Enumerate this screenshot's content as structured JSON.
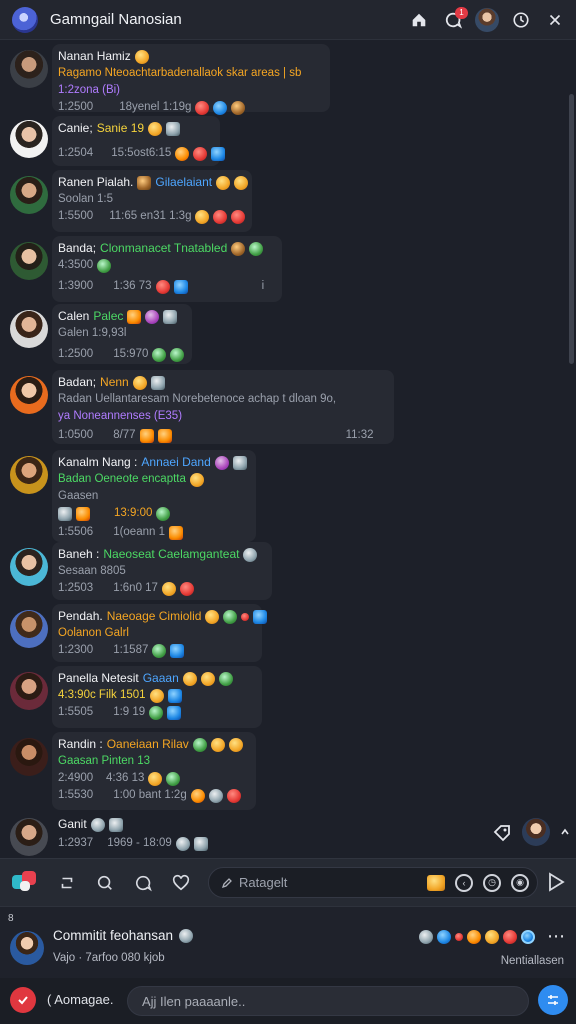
{
  "app": {
    "title": "Gamngail Nanosian"
  },
  "topbar": {
    "badge": "1"
  },
  "messages": [
    {
      "name": "Nanan Hamiz",
      "lines": [
        "Ragamo Nteoachtarbadenallaok skar areas | sb",
        "1:2zona (Bi)"
      ],
      "time": "1:2500",
      "meta": "18yenel 1:19g"
    },
    {
      "name": "Canie;",
      "tag": "Sanie 19",
      "time": "1:2504",
      "meta": "15:5ost6:15"
    },
    {
      "name": "Ranen Pialah.",
      "tag": "Gilaelaiant",
      "lines": [
        "Soolan 1:5"
      ],
      "time": "1:5500",
      "meta": "11:65 en31 1:3g"
    },
    {
      "name": "Banda;",
      "tag": "Clonmanacet Tnatabled",
      "lines": [
        "4:3500"
      ],
      "time": "1:3900",
      "meta": "1:36 73",
      "extra": "i"
    },
    {
      "name": "Calen",
      "tag": "Palec",
      "lines": [
        "Galen 1:9,93l"
      ],
      "time": "1:2500",
      "meta": "15:970"
    },
    {
      "name": "Badan;",
      "tag": "Nenn",
      "lines": [
        "Radan Uellantaresam Norebetenoce achap t dloan 9o,",
        "ya Noneannenses (E35)"
      ],
      "time": "1:0500",
      "meta": "8/77",
      "right": "11:32"
    },
    {
      "name": "Kanalm Nang :",
      "tag": "Annaei Dand",
      "lines": [
        "Badan Oeneote encaptta",
        "Gaasen",
        "13:9:00"
      ],
      "time": "1:5506",
      "meta": "1(oeann 1"
    },
    {
      "name": "Baneh :",
      "tag": "Naeoseat Caelamganteat",
      "lines": [
        "Sesaan 8805"
      ],
      "time": "1:2503",
      "meta": "1:6n0 17"
    },
    {
      "name": "Pendah.",
      "tag": "Naeoage Cimiolid",
      "lines": [
        "Oolanon Galrl"
      ],
      "time": "1:2300",
      "meta": "1:1587"
    },
    {
      "name": "Panella Netesit",
      "tag": "Gaaan",
      "lines": [
        "4:3:90c Filk 1501"
      ],
      "time": "1:5505",
      "meta": "1:9 19"
    },
    {
      "name": "Randin :",
      "tag": "Oaneiaan Rilav",
      "lines": [
        "Gaasan Pinten 13",
        "2:4900",
        "4:36 13"
      ],
      "time": "1:5530",
      "meta": "1:00 bant 1:2g"
    },
    {
      "name": "Ganit",
      "time": "1:2937",
      "meta": "1969 - 18:09"
    }
  ],
  "composer": {
    "search_placeholder": "Ratagelt"
  },
  "profile": {
    "small": "8",
    "name": "Commitit feohansan",
    "status": "Vajo · 7arfoo 080 kjob",
    "link": "Nentiallasen"
  },
  "bottom": {
    "label": "( Aomagae.",
    "placeholder": "Ajj Ilen paaaanle.."
  },
  "colors": {
    "background": "#1d2029",
    "bubble": "#272a33",
    "accent_blue": "#2f8cf0",
    "accent_red": "#e0373f"
  },
  "icons": [
    "home-icon",
    "chat-icon",
    "clock-icon",
    "close-icon",
    "search-icon",
    "send-icon",
    "heart-icon"
  ]
}
